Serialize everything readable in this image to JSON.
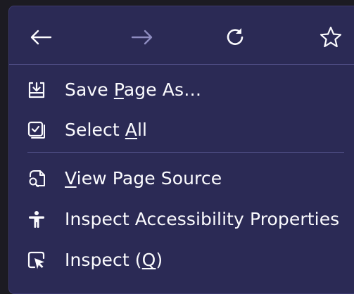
{
  "navbar": {
    "back_icon": "arrow-left-icon",
    "forward_icon": "arrow-right-icon",
    "reload_icon": "reload-icon",
    "bookmark_icon": "star-icon"
  },
  "items": [
    {
      "label": "Save Page As…",
      "icon": "save-page-icon",
      "accesskey": "P"
    },
    {
      "label": "Select All",
      "icon": "select-all-icon",
      "accesskey": "A"
    },
    {
      "label": "View Page Source",
      "icon": "page-source-icon",
      "accesskey": "V"
    },
    {
      "label": "Inspect Accessibility Properties",
      "icon": "accessibility-icon"
    },
    {
      "label": "Inspect (Q)",
      "icon": "inspect-icon",
      "accesskey": "Q"
    }
  ],
  "colors": {
    "background": "#2b2a55",
    "text": "#fbfbfe",
    "disabled": "#8e8cc0",
    "separator": "#53518a"
  }
}
